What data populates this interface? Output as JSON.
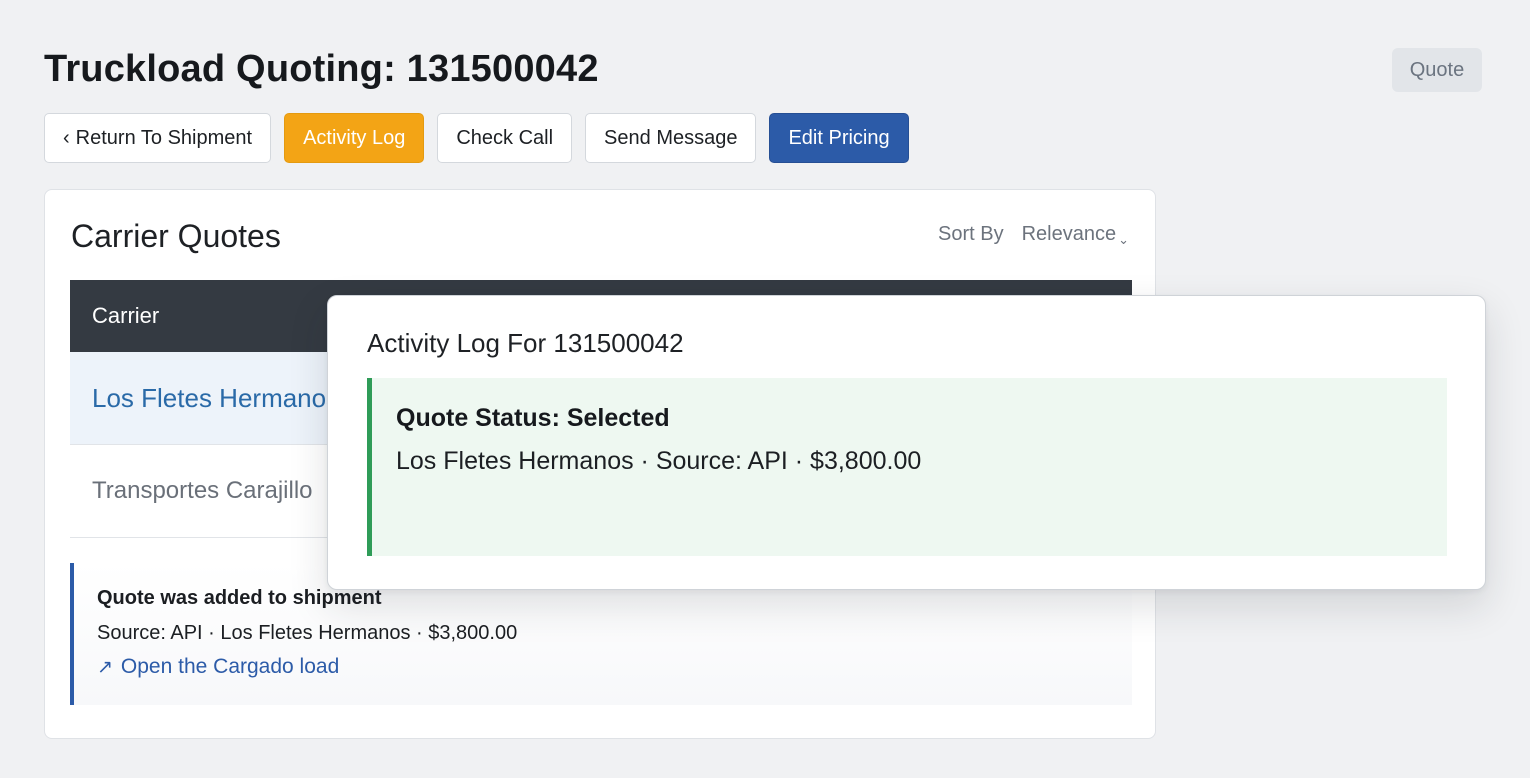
{
  "header": {
    "title": "Truckload Quoting: 131500042",
    "status_label": "Quote"
  },
  "toolbar": {
    "return_label": "Return To Shipment",
    "return_chevron": "‹",
    "activity_log_label": "Activity Log",
    "check_call_label": "Check Call",
    "send_message_label": "Send Message",
    "edit_pricing_label": "Edit Pricing"
  },
  "carrier_quotes": {
    "title": "Carrier Quotes",
    "sort_label": "Sort By",
    "sort_value": "Relevance",
    "columns": [
      "Carrier"
    ],
    "rows": [
      {
        "carrier": "Los Fletes Hermanos",
        "selected": true
      },
      {
        "carrier": "Transportes Carajillo",
        "selected": false
      }
    ]
  },
  "note": {
    "title": "Quote was added to shipment",
    "detail": "Source: API · Los Fletes Hermanos · $3,800.00",
    "link_label": "Open the Cargado load",
    "link_icon": "external-arrow-icon"
  },
  "activity_log": {
    "title": "Activity Log For 131500042",
    "entries": [
      {
        "title": "Quote Status: Selected",
        "detail": "Los Fletes Hermanos · Source: API · $3,800.00"
      }
    ]
  },
  "colors": {
    "accent_orange": "#f3a415",
    "accent_blue": "#2c5ba8",
    "header_dark": "#343a42",
    "success_green": "#2f9c58"
  }
}
